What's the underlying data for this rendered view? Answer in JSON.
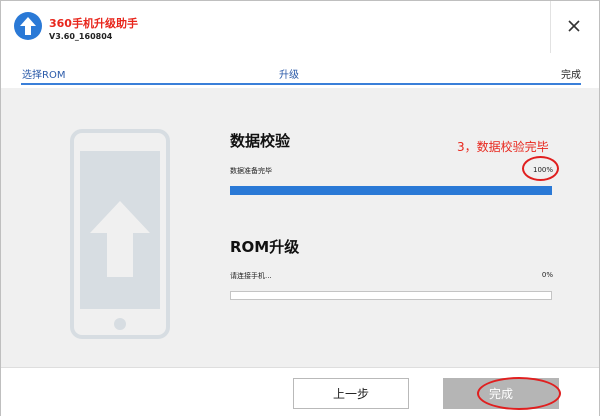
{
  "app": {
    "title": "360手机升级助手",
    "version": "V3.60_160804",
    "accent": "#2a79d6",
    "brand_red": "#e8261c"
  },
  "steps": [
    {
      "label": "选择ROM",
      "state": "completed"
    },
    {
      "label": "升级",
      "state": "completed"
    },
    {
      "label": "完成",
      "state": "current"
    }
  ],
  "verify": {
    "title": "数据校验",
    "status": "数据准备完毕",
    "percent_label": "100%",
    "progress": 1.0,
    "annotation": "3，数据校验完毕"
  },
  "rom": {
    "title": "ROM升级",
    "status": "请连接手机...",
    "percent_label": "0%",
    "progress": 0.0
  },
  "buttons": {
    "prev": "上一步",
    "done": "完成"
  },
  "icons": [
    "upload-arrow-icon",
    "close-icon",
    "phone-upgrade-icon"
  ]
}
